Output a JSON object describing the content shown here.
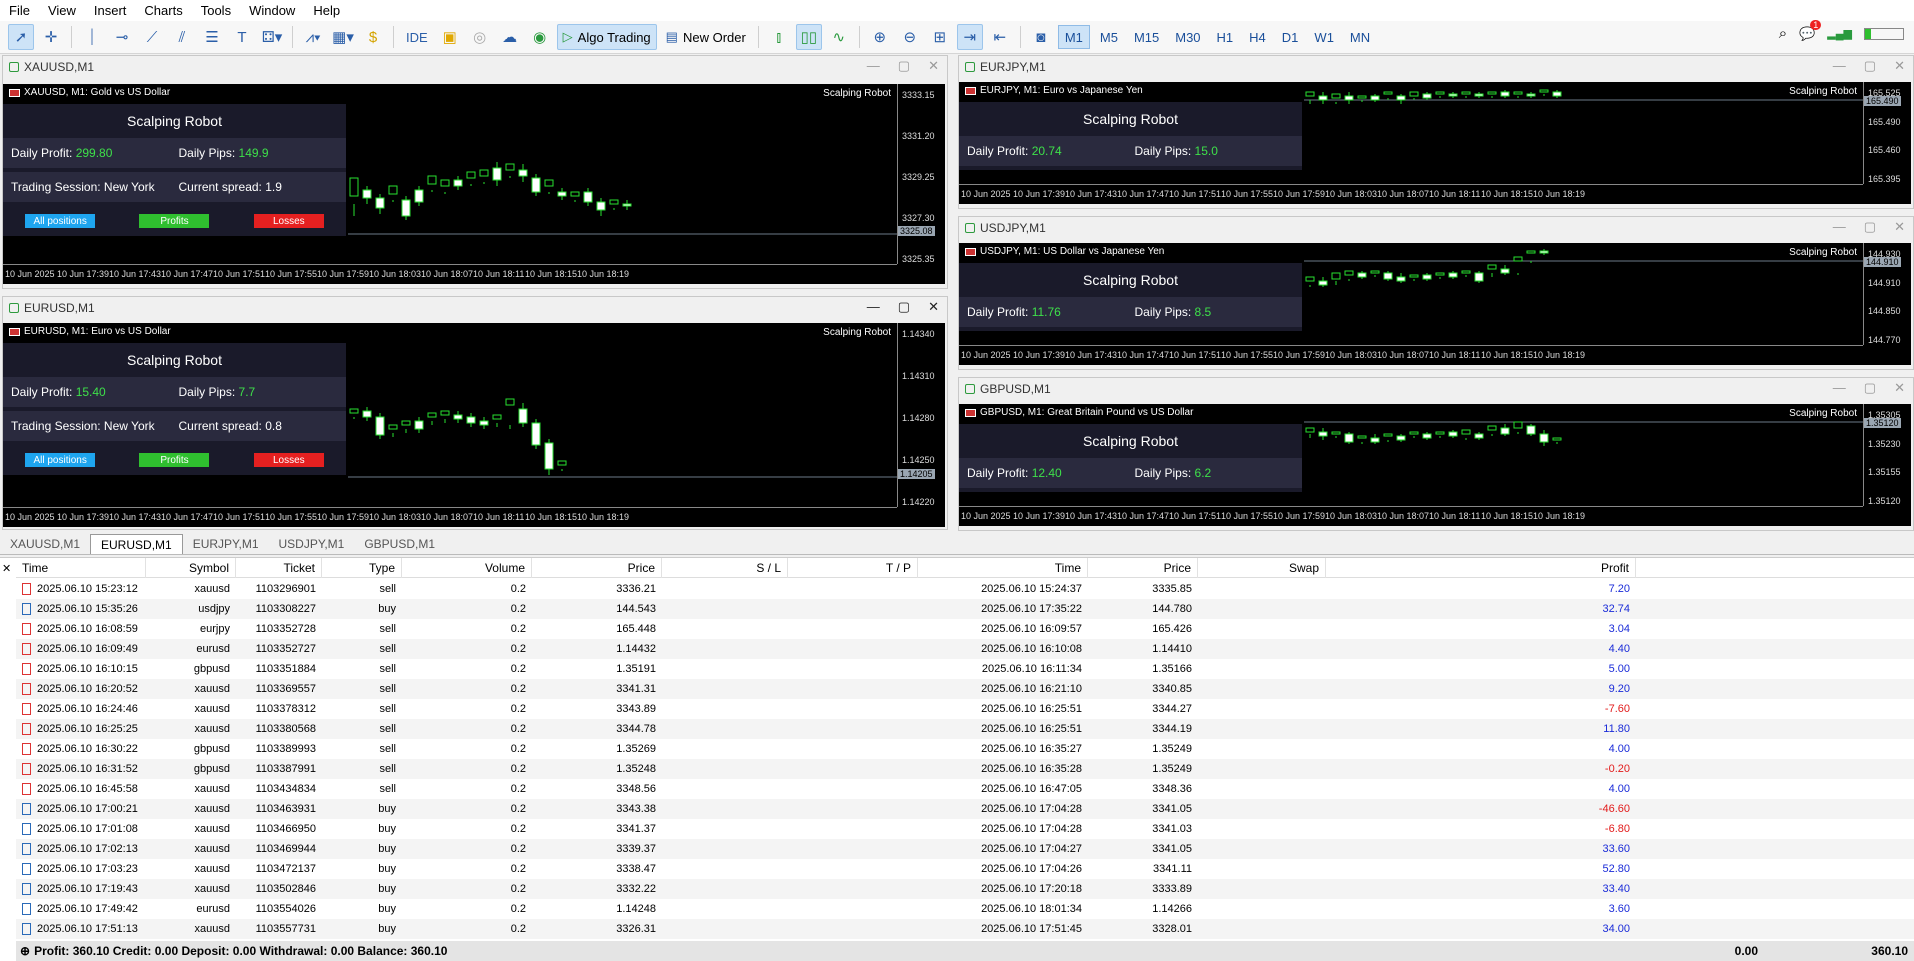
{
  "menu": [
    "File",
    "View",
    "Insert",
    "Charts",
    "Tools",
    "Window",
    "Help"
  ],
  "toolbar": {
    "ide": "IDE",
    "algo": "Algo Trading",
    "order": "New Order",
    "timeframes": [
      "M1",
      "M5",
      "M15",
      "M30",
      "H1",
      "H4",
      "D1",
      "W1",
      "MN"
    ],
    "active_tf": "M1",
    "notif": "1"
  },
  "charts": [
    {
      "id": "xau",
      "title": "XAUUSD,M1",
      "header": "XAUUSD, M1:  Gold vs US Dollar",
      "robot": "Scalping Robot",
      "prices": [
        "3333.15",
        "3331.20",
        "3329.25",
        "3327.30",
        "3325.35"
      ],
      "tag": "3325.08",
      "panel": {
        "title": "Scalping Robot",
        "dp_label": "Daily Profit:",
        "dp": "299.80",
        "pips_label": "Daily Pips:",
        "pips": "149.9",
        "session": "Trading Session: New York",
        "spread_label": "Current spread:",
        "spread": "1.9"
      }
    },
    {
      "id": "eur",
      "title": "EURUSD,M1",
      "header": "EURUSD, M1:  Euro vs US Dollar",
      "robot": "Scalping Robot",
      "prices": [
        "1.14340",
        "1.14310",
        "1.14280",
        "1.14250",
        "1.14220"
      ],
      "tag": "1.14205",
      "panel": {
        "title": "Scalping Robot",
        "dp_label": "Daily Profit:",
        "dp": "15.40",
        "pips_label": "Daily Pips:",
        "pips": "7.7",
        "session": "Trading Session: New York",
        "spread_label": "Current spread:",
        "spread": "0.8"
      }
    },
    {
      "id": "eurjpy",
      "title": "EURJPY,M1",
      "header": "EURJPY, M1:  Euro vs Japanese Yen",
      "robot": "Scalping Robot",
      "prices": [
        "165.525",
        "165.490",
        "165.460",
        "165.395"
      ],
      "tag": "165.490",
      "panel": {
        "title": "Scalping Robot",
        "dp_label": "Daily Profit:",
        "dp": "20.74",
        "pips_label": "Daily Pips:",
        "pips": "15.0"
      }
    },
    {
      "id": "usdjpy",
      "title": "USDJPY,M1",
      "header": "USDJPY, M1:  US Dollar vs Japanese Yen",
      "robot": "Scalping Robot",
      "prices": [
        "144.930",
        "144.910",
        "144.850",
        "144.770"
      ],
      "tag": "144.910",
      "panel": {
        "title": "Scalping Robot",
        "dp_label": "Daily Profit:",
        "dp": "11.76",
        "pips_label": "Daily Pips:",
        "pips": "8.5"
      }
    },
    {
      "id": "gbp",
      "title": "GBPUSD,M1",
      "header": "GBPUSD, M1:  Great Britain Pound vs US Dollar",
      "robot": "Scalping Robot",
      "prices": [
        "1.35305",
        "1.35230",
        "1.35155",
        "1.35120"
      ],
      "tag": "1.35120",
      "panel": {
        "title": "Scalping Robot",
        "dp_label": "Daily Profit:",
        "dp": "12.40",
        "pips_label": "Daily Pips:",
        "pips": "6.2"
      }
    }
  ],
  "panel_buttons": [
    "All positions",
    "Profits",
    "Losses"
  ],
  "time_labels": [
    "10 Jun 2025",
    "10 Jun 17:39",
    "10 Jun 17:43",
    "10 Jun 17:47",
    "10 Jun 17:51",
    "10 Jun 17:55",
    "10 Jun 17:59",
    "10 Jun 18:03",
    "10 Jun 18:07",
    "10 Jun 18:11",
    "10 Jun 18:15",
    "10 Jun 18:19"
  ],
  "tabs": [
    "XAUUSD,M1",
    "EURUSD,M1",
    "EURJPY,M1",
    "USDJPY,M1",
    "GBPUSD,M1"
  ],
  "active_tab": "EURUSD,M1",
  "columns": [
    "Time",
    "Symbol",
    "Ticket",
    "Type",
    "Volume",
    "Price",
    "S / L",
    "T / P",
    "Time",
    "Price",
    "Swap",
    "Profit"
  ],
  "rows": [
    [
      "2025.06.10 15:23:12",
      "xauusd",
      "1103296901",
      "sell",
      "0.2",
      "3336.21",
      "",
      "",
      "2025.06.10 15:24:37",
      "3335.85",
      "",
      "7.20"
    ],
    [
      "2025.06.10 15:35:26",
      "usdjpy",
      "1103308227",
      "buy",
      "0.2",
      "144.543",
      "",
      "",
      "2025.06.10 17:35:22",
      "144.780",
      "",
      "32.74"
    ],
    [
      "2025.06.10 16:08:59",
      "eurjpy",
      "1103352728",
      "sell",
      "0.2",
      "165.448",
      "",
      "",
      "2025.06.10 16:09:57",
      "165.426",
      "",
      "3.04"
    ],
    [
      "2025.06.10 16:09:49",
      "eurusd",
      "1103352727",
      "sell",
      "0.2",
      "1.14432",
      "",
      "",
      "2025.06.10 16:10:08",
      "1.14410",
      "",
      "4.40"
    ],
    [
      "2025.06.10 16:10:15",
      "gbpusd",
      "1103351884",
      "sell",
      "0.2",
      "1.35191",
      "",
      "",
      "2025.06.10 16:11:34",
      "1.35166",
      "",
      "5.00"
    ],
    [
      "2025.06.10 16:20:52",
      "xauusd",
      "1103369557",
      "sell",
      "0.2",
      "3341.31",
      "",
      "",
      "2025.06.10 16:21:10",
      "3340.85",
      "",
      "9.20"
    ],
    [
      "2025.06.10 16:24:46",
      "xauusd",
      "1103378312",
      "sell",
      "0.2",
      "3343.89",
      "",
      "",
      "2025.06.10 16:25:51",
      "3344.27",
      "",
      "-7.60"
    ],
    [
      "2025.06.10 16:25:25",
      "xauusd",
      "1103380568",
      "sell",
      "0.2",
      "3344.78",
      "",
      "",
      "2025.06.10 16:25:51",
      "3344.19",
      "",
      "11.80"
    ],
    [
      "2025.06.10 16:30:22",
      "gbpusd",
      "1103389993",
      "sell",
      "0.2",
      "1.35269",
      "",
      "",
      "2025.06.10 16:35:27",
      "1.35249",
      "",
      "4.00"
    ],
    [
      "2025.06.10 16:31:52",
      "gbpusd",
      "1103387991",
      "sell",
      "0.2",
      "1.35248",
      "",
      "",
      "2025.06.10 16:35:28",
      "1.35249",
      "",
      "-0.20"
    ],
    [
      "2025.06.10 16:45:58",
      "xauusd",
      "1103434834",
      "sell",
      "0.2",
      "3348.56",
      "",
      "",
      "2025.06.10 16:47:05",
      "3348.36",
      "",
      "4.00"
    ],
    [
      "2025.06.10 17:00:21",
      "xauusd",
      "1103463931",
      "buy",
      "0.2",
      "3343.38",
      "",
      "",
      "2025.06.10 17:04:28",
      "3341.05",
      "",
      "-46.60"
    ],
    [
      "2025.06.10 17:01:08",
      "xauusd",
      "1103466950",
      "buy",
      "0.2",
      "3341.37",
      "",
      "",
      "2025.06.10 17:04:28",
      "3341.03",
      "",
      "-6.80"
    ],
    [
      "2025.06.10 17:02:13",
      "xauusd",
      "1103469944",
      "buy",
      "0.2",
      "3339.37",
      "",
      "",
      "2025.06.10 17:04:27",
      "3341.05",
      "",
      "33.60"
    ],
    [
      "2025.06.10 17:03:23",
      "xauusd",
      "1103472137",
      "buy",
      "0.2",
      "3338.47",
      "",
      "",
      "2025.06.10 17:04:26",
      "3341.11",
      "",
      "52.80"
    ],
    [
      "2025.06.10 17:19:43",
      "xauusd",
      "1103502846",
      "buy",
      "0.2",
      "3332.22",
      "",
      "",
      "2025.06.10 17:20:18",
      "3333.89",
      "",
      "33.40"
    ],
    [
      "2025.06.10 17:49:42",
      "eurusd",
      "1103554026",
      "buy",
      "0.2",
      "1.14248",
      "",
      "",
      "2025.06.10 18:01:34",
      "1.14266",
      "",
      "3.60"
    ],
    [
      "2025.06.10 17:51:13",
      "xauusd",
      "1103557731",
      "buy",
      "0.2",
      "3326.31",
      "",
      "",
      "2025.06.10 17:51:45",
      "3328.01",
      "",
      "34.00"
    ]
  ],
  "summary": {
    "text": "Profit: 360.10  Credit: 0.00  Deposit: 0.00  Withdrawal: 0.00  Balance: 360.10",
    "swap": "0.00",
    "profit": "360.10"
  }
}
